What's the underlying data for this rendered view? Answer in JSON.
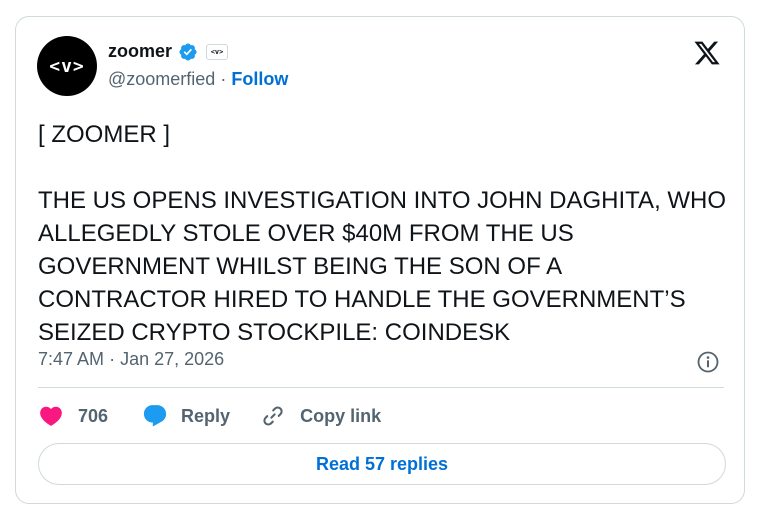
{
  "author": {
    "avatar_text": "<v>",
    "display_name": "zoomer",
    "affiliate_badge_text": "<v>",
    "handle": "@zoomerfied",
    "separator": "·",
    "follow_label": "Follow"
  },
  "tweet": {
    "text": "[ ZOOMER ]\n\nTHE US OPENS INVESTIGATION INTO JOHN DAGHITA, WHO ALLEGEDLY STOLE OVER $40M FROM THE US GOVERNMENT WHILST BEING THE SON OF A CONTRACTOR HIRED TO HANDLE THE GOVERNMENT’S SEIZED CRYPTO STOCKPILE: COINDESK",
    "time": "7:47 AM",
    "date_separator": "·",
    "date": "Jan 27, 2026"
  },
  "actions": {
    "like_count": "706",
    "reply_label": "Reply",
    "copy_link_label": "Copy link"
  },
  "read_replies_label": "Read 57 replies",
  "icons": {
    "verified": "verified-badge-icon",
    "x_logo": "x-logo-icon",
    "info": "info-icon",
    "heart": "heart-icon",
    "reply": "speech-bubble-icon",
    "link": "link-icon"
  },
  "colors": {
    "link_blue": "#006fd6",
    "verified_blue": "#1d9bf0",
    "heart_pink": "#f91880",
    "secondary_text": "#536471",
    "border": "#cfd9de"
  }
}
